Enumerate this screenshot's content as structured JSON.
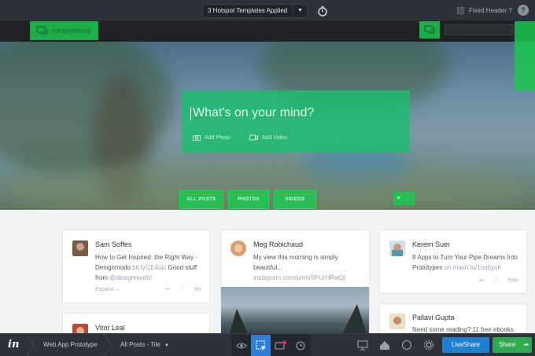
{
  "toolbar": {
    "template_select": "3 Hotspot Templates Applied",
    "fixed_header_label": "Fixed Header ?",
    "help_label": "?"
  },
  "site": {
    "brand": "simplysocial"
  },
  "composer": {
    "placeholder": "What's on your mind?",
    "add_photo": "Add Photo",
    "add_video": "Add Video"
  },
  "filters": [
    "ALL POSTS",
    "PHOTOS",
    "VIDEOS"
  ],
  "posts": [
    {
      "name": "Sam Soffes",
      "body_pre": "How to Get Inspired: the Right Way - Designmodo ",
      "link": "bit.ly/1E4ujc",
      "body_mid": " Good stuff from ",
      "handle": "@designmodo!",
      "expand": "Expand",
      "time": "3m"
    },
    {
      "name": "Meg Robichaud",
      "body": "My view this morning is simply beautiful...",
      "link": "instagram.com/p/mV0PUrHRwQ/"
    },
    {
      "name": "Kerem Suer",
      "body": "8 Apps to Turn Your Pipe Dreams Into Prototypes ",
      "link": "on.mash.to/1oubyuIl",
      "time": "50m"
    },
    {
      "name": "Vitor Leal"
    },
    {
      "name": "Pallavi Gupta",
      "body": "Need some reading? 11 free ebooks"
    }
  ],
  "bottombar": {
    "logo": "in",
    "project": "Web App Prototype",
    "screen": "All Posts - Tile",
    "liveshare": "LiveShare",
    "share": "Share"
  },
  "colors": {
    "hotspot_green": "#1ac850",
    "liveshare_blue": "#1f7fd0",
    "share_green": "#2faa4f",
    "active_tool": "#2f7fd6"
  }
}
